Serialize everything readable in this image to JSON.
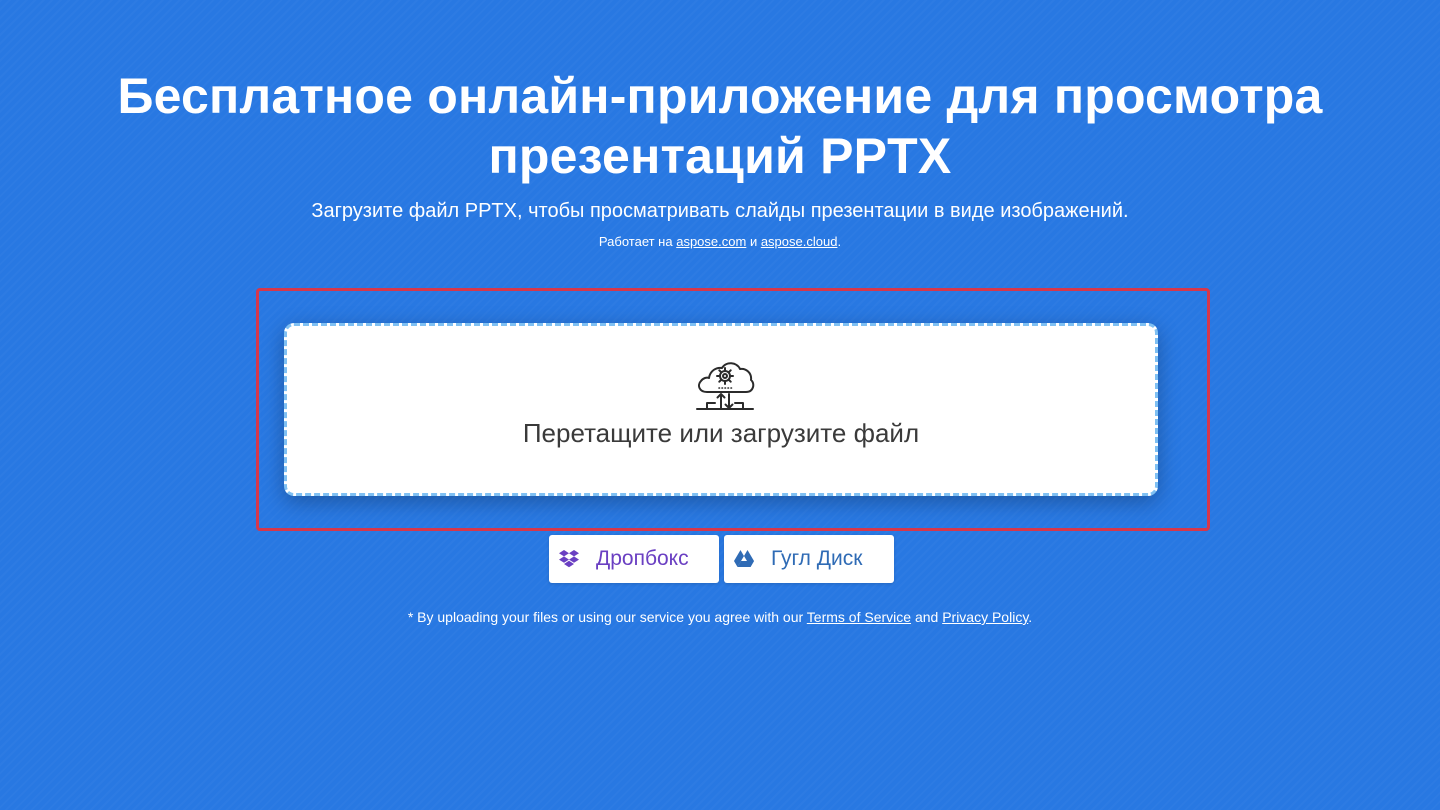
{
  "header": {
    "title_line1": "Бесплатное онлайн-приложение для просмотра",
    "title_line2": "презентаций PPTX",
    "subtitle": "Загрузите файл PPTX, чтобы просматривать слайды презентации в виде изображений.",
    "powered": {
      "prefix": "Работает на",
      "link1": "aspose.com",
      "conjunction": "и",
      "link2": "aspose.cloud",
      "suffix": "."
    }
  },
  "upload": {
    "drop_label": "Перетащите или загрузите файл",
    "icon": "cloud-upload-gear-icon"
  },
  "cloud_buttons": {
    "dropbox": {
      "label": "Дропбокс",
      "icon": "dropbox-icon"
    },
    "gdrive": {
      "label": "Гугл Диск",
      "icon": "google-drive-icon"
    }
  },
  "terms": {
    "prefix": "* By uploading your files or using our service you agree with our",
    "tos_link": "Terms of Service",
    "conjunction": "and",
    "privacy_link": "Privacy Policy",
    "suffix": "."
  },
  "colors": {
    "background": "#2878e2",
    "highlight_border": "#d6374b",
    "drop_border": "#7fc0f3",
    "dropbox": "#6a3fc2",
    "gdrive": "#2f6bb5"
  }
}
